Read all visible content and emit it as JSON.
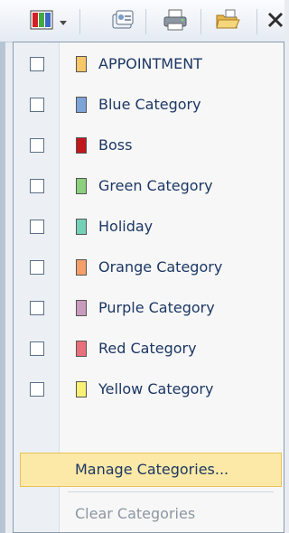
{
  "toolbar": {
    "buttons": [
      {
        "name": "categorize",
        "icon": "color-categories-icon",
        "has_dropdown": true
      },
      {
        "name": "address-book",
        "icon": "address-card-icon"
      },
      {
        "name": "print",
        "icon": "printer-icon"
      },
      {
        "name": "open-folder",
        "icon": "open-folder-icon"
      },
      {
        "name": "delete",
        "icon": "close-icon"
      }
    ]
  },
  "menu": {
    "categories": [
      {
        "label": "APPOINTMENT",
        "checked": false,
        "color": "#f9c66a"
      },
      {
        "label": "Blue Category",
        "checked": false,
        "color": "#7ea3d8"
      },
      {
        "label": "Boss",
        "checked": false,
        "color": "#c0171d"
      },
      {
        "label": "Green Category",
        "checked": false,
        "color": "#8ccf7c"
      },
      {
        "label": "Holiday",
        "checked": false,
        "color": "#74d1b7"
      },
      {
        "label": "Orange Category",
        "checked": false,
        "color": "#f5a06a"
      },
      {
        "label": "Purple Category",
        "checked": false,
        "color": "#c99bbd"
      },
      {
        "label": "Red Category",
        "checked": false,
        "color": "#e8707a"
      },
      {
        "label": "Yellow Category",
        "checked": false,
        "color": "#f8f176"
      }
    ],
    "manage_label": "Manage Categories...",
    "clear_label": "Clear Categories"
  }
}
